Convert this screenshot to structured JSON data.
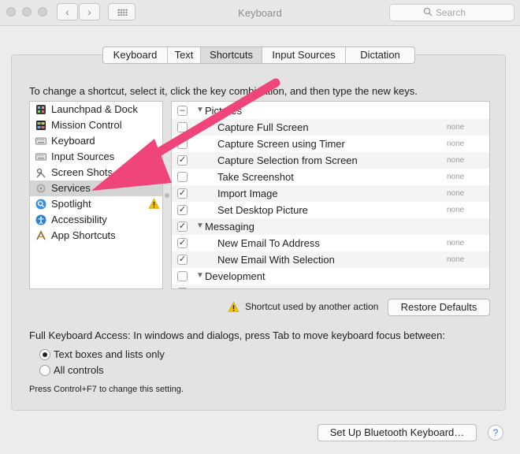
{
  "window": {
    "title": "Keyboard",
    "search_placeholder": "Search",
    "back_glyph": "‹",
    "forward_glyph": "›"
  },
  "tabs": [
    {
      "label": "Keyboard"
    },
    {
      "label": "Text"
    },
    {
      "label": "Shortcuts",
      "active": true
    },
    {
      "label": "Input Sources"
    },
    {
      "label": "Dictation"
    }
  ],
  "instructions": "To change a shortcut, select it, click the key combination, and then type the new keys.",
  "categories": [
    {
      "label": "Launchpad & Dock",
      "icon": "launchpad-icon"
    },
    {
      "label": "Mission Control",
      "icon": "mission-control-icon"
    },
    {
      "label": "Keyboard",
      "icon": "keyboard-icon"
    },
    {
      "label": "Input Sources",
      "icon": "input-sources-icon"
    },
    {
      "label": "Screen Shots",
      "icon": "screenshot-icon"
    },
    {
      "label": "Services",
      "icon": "gear-icon",
      "selected": true
    },
    {
      "label": "Spotlight",
      "icon": "spotlight-icon",
      "warning": true
    },
    {
      "label": "Accessibility",
      "icon": "accessibility-icon"
    },
    {
      "label": "App Shortcuts",
      "icon": "app-shortcuts-icon"
    }
  ],
  "shortcuts": [
    {
      "type": "group",
      "label": "Pictures",
      "checkbox": "mixed"
    },
    {
      "type": "item",
      "label": "Capture Full Screen",
      "checked": false,
      "key": "none"
    },
    {
      "type": "item",
      "label": "Capture Screen using Timer",
      "checked": false,
      "key": "none"
    },
    {
      "type": "item",
      "label": "Capture Selection from Screen",
      "checked": true,
      "key": "none"
    },
    {
      "type": "item",
      "label": "Take Screenshot",
      "checked": false,
      "key": "none"
    },
    {
      "type": "item",
      "label": "Import Image",
      "checked": true,
      "key": "none"
    },
    {
      "type": "item",
      "label": "Set Desktop Picture",
      "checked": true,
      "key": "none"
    },
    {
      "type": "group",
      "label": "Messaging",
      "checkbox": "checked"
    },
    {
      "type": "item",
      "label": "New Email To Address",
      "checked": true,
      "key": "none"
    },
    {
      "type": "item",
      "label": "New Email With Selection",
      "checked": true,
      "key": "none"
    },
    {
      "type": "group",
      "label": "Development",
      "checkbox": "unchecked"
    }
  ],
  "conflict_note": "Shortcut used by another action",
  "restore_defaults": "Restore Defaults",
  "full_keyboard_access": {
    "label": "Full Keyboard Access: In windows and dialogs, press Tab to move keyboard focus between:",
    "options": [
      {
        "label": "Text boxes and lists only",
        "selected": true
      },
      {
        "label": "All controls",
        "selected": false
      }
    ],
    "hint": "Press Control+F7 to change this setting."
  },
  "bluetooth_button": "Set Up Bluetooth Keyboard…",
  "help_glyph": "?",
  "colors": {
    "arrow": "#f0457b",
    "selection": "#d4d4d4",
    "warning": "#f2c200"
  }
}
